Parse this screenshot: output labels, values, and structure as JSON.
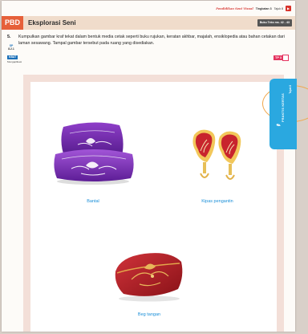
{
  "header": {
    "subject": "Pendidikan Seni Visual",
    "level": "Tingkatan 3",
    "unit": "Tajuk 8",
    "pdf_icon": "pdf-icon",
    "code": "PBD",
    "title": "Eksplorasi Seni",
    "textbook_ref": "Buku Teks ms. 42 - 43"
  },
  "question": {
    "number": "5.",
    "text": "Kumpulkan gambar kraf tekat dalam bentuk media cetak seperti buku rujukan, keratan akhbar, majalah, ensiklopedia atau bahan cetakan dari laman sesawang. Tampal gambar tersebut pada ruang yang disediakan.",
    "sp_label": "SP",
    "sp_code": "8.2.1",
    "kbat_label": "KBAT",
    "kbat_sub": "Mengaplikasi",
    "tp_label": "TP 3"
  },
  "items": [
    {
      "caption": "Bantal"
    },
    {
      "caption": "Kipas pengantin"
    },
    {
      "caption": "Beg tangan"
    }
  ],
  "side_tab": {
    "label": "PRAKTIS KERTAS",
    "sub": "Tajuk 8",
    "icon": "pencil-icon"
  },
  "colors": {
    "accent_orange": "#e6603a",
    "band": "#f0dccb",
    "caption_blue": "#1a8fd8",
    "tab_blue": "#2aa8e0",
    "tp_pink": "#e4335f"
  }
}
